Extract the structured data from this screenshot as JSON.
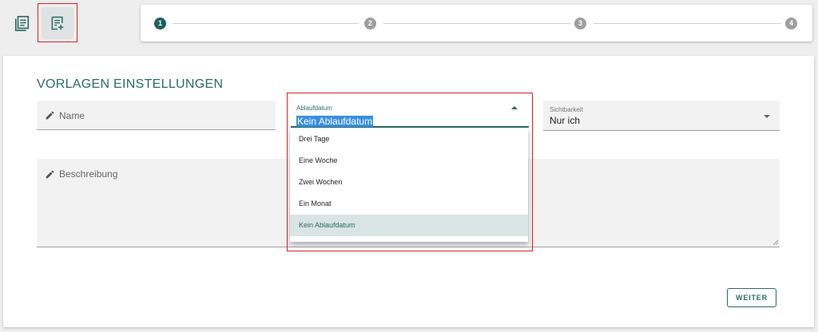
{
  "toolbar": {
    "templates_icon": "list-document-icon",
    "new_template_icon": "add-document-icon"
  },
  "stepper": {
    "steps": [
      "1",
      "2",
      "3",
      "4"
    ],
    "active_color": "#1f5f5a",
    "inactive_color": "#9e9e9e"
  },
  "form": {
    "title": "VORLAGEN EINSTELLUNGEN",
    "name_placeholder": "Name",
    "expiry_label": "Ablaufdatum",
    "expiry_value": "Kein Ablaufdatum",
    "expiry_options": [
      "Drei Tage",
      "Eine Woche",
      "Zwei Wochen",
      "Ein Monat",
      "Kein Ablaufdatum"
    ],
    "visibility_label": "Sichtbarkeit",
    "visibility_value": "Nur ich",
    "description_placeholder": "Beschreibung",
    "next_button": "WEITER"
  },
  "colors": {
    "accent": "#2b6b66",
    "highlight_box": "#e0201f"
  }
}
